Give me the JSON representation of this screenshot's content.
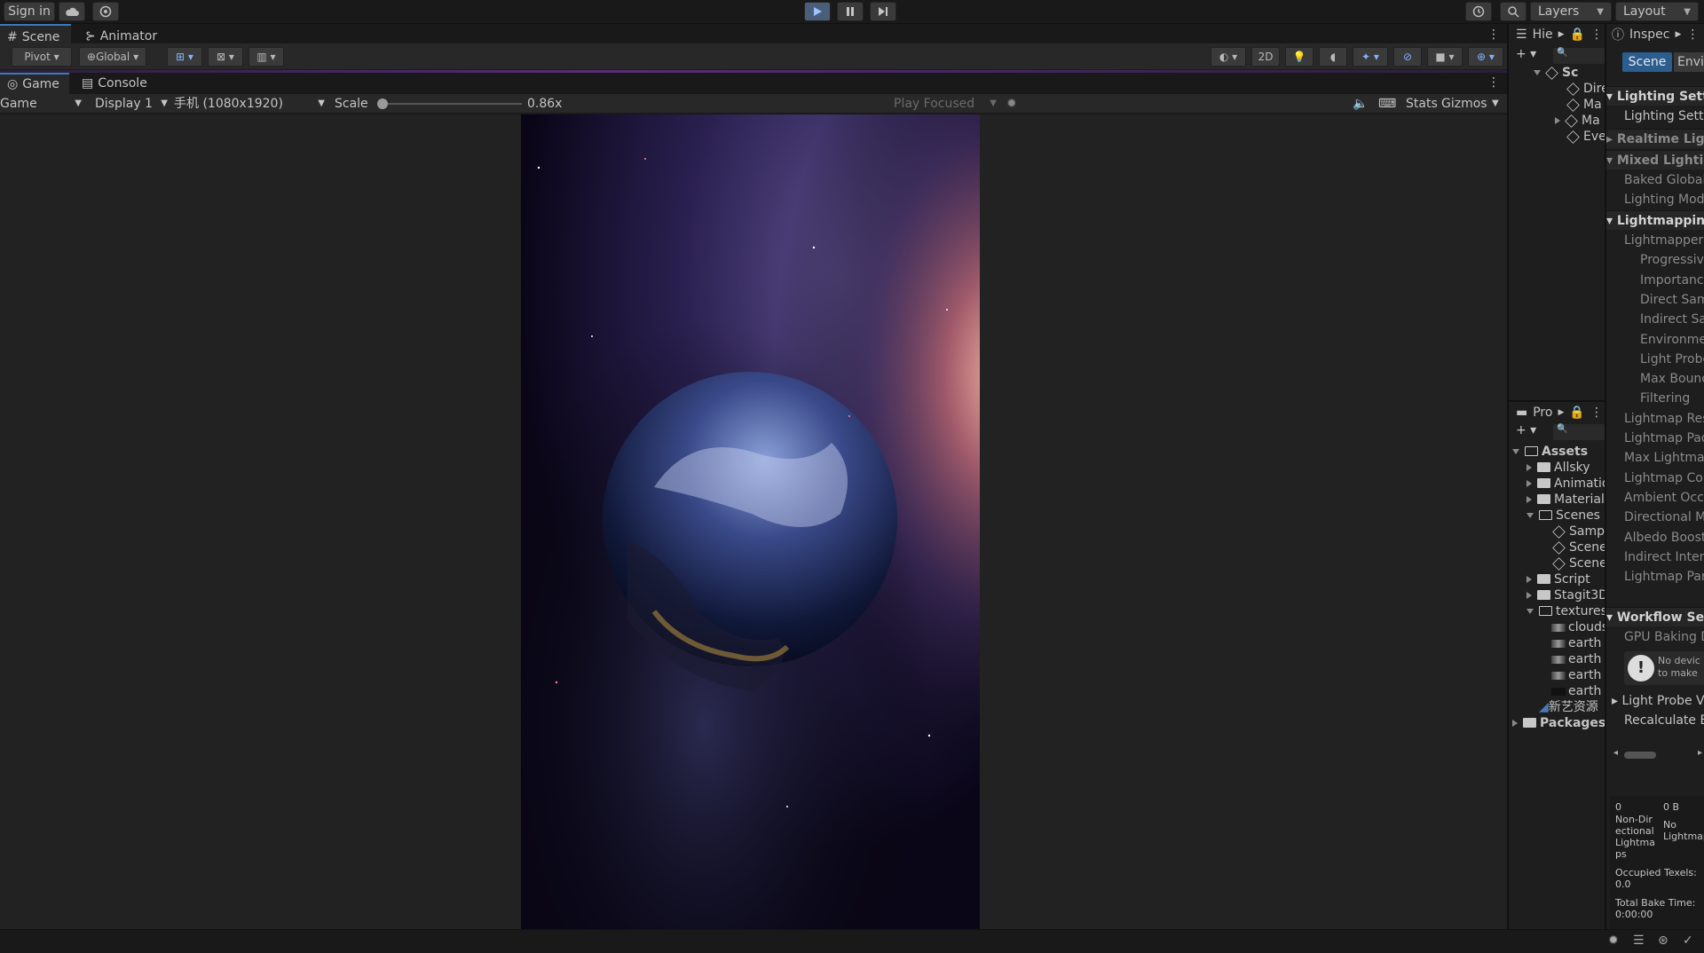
{
  "topbar": {
    "sign_in": "Sign in",
    "layers": "Layers",
    "layout": "Layout"
  },
  "scene_tabs": {
    "scene": "Scene",
    "animator": "Animator"
  },
  "scene_toolbar": {
    "pivot": "Pivot",
    "global": "Global",
    "mode_2d": "2D"
  },
  "game_tabs": {
    "game": "Game",
    "console": "Console"
  },
  "game_bar": {
    "mode": "Game",
    "display": "Display 1",
    "resolution": "手机 (1080x1920)",
    "scale_label": "Scale",
    "scale_value": "0.86x",
    "scale_fraction": 0.0,
    "play_focused": "Play Focused",
    "stats": "Stats",
    "gizmos": "Gizmos"
  },
  "hierarchy": {
    "tab": "Hie",
    "scene_item": "Sc",
    "items": [
      "Dire",
      "Ma",
      "Ma",
      "Eve"
    ]
  },
  "project": {
    "tab": "Pro",
    "assets": "Assets",
    "folders": [
      "Allsky",
      "Animatio",
      "Materials"
    ],
    "scenes_folder": "Scenes",
    "scenes": [
      "Sampl",
      "Scene",
      "Scene"
    ],
    "script": "Script",
    "stagit": "Stagit3D",
    "textures": "textures",
    "texture_items": [
      "clouds",
      "earth a",
      "earth b",
      "earth l",
      "earth n"
    ],
    "xinyi": "新艺资源",
    "packages": "Packages"
  },
  "inspector": {
    "tab": "Inspec",
    "btn_scene": "Scene",
    "btn_env": "Envir",
    "headers": {
      "lighting_settings": "Lighting Setti",
      "realtime": "Realtime Ligh",
      "mixed": "Mixed Lightin",
      "lightmapping": "Lightmapping",
      "workflow": "Workflow Set"
    },
    "lighting_settings_row": "Lighting Settin",
    "mixed_rows": [
      "Baked Global I",
      "Lighting Mode"
    ],
    "lightmapping_rows": [
      "Lightmapper",
      "Progressive",
      "Importance",
      "Direct Samp",
      "Indirect San",
      "Environmen",
      "Light Probe",
      "Max Bounce",
      "Filtering",
      "Lightmap Res",
      "Lightmap Padd",
      "Max Lightmap",
      "Lightmap Com",
      "Ambient Occlu",
      "Directional Mo",
      "Albedo Boost",
      "Indirect Intens",
      "Lightmap Para"
    ],
    "workflow_rows": [
      "GPU Baking D"
    ],
    "warning": "No devic to make",
    "light_probe_vis": "Light Probe Vis",
    "recalculate": "Recalculate Er",
    "stats": {
      "count": "0",
      "size": "0 B",
      "non_directional": "Non-Directional Lightmaps",
      "no_lightmaps": "No Lightmaps",
      "occupied": "Occupied Texels: 0.0",
      "bake_time": "Total Bake Time: 0:00:00"
    }
  },
  "colors": {
    "play_active": "#4a5e7a",
    "accent": "#3a79bb",
    "panel": "#282828"
  }
}
